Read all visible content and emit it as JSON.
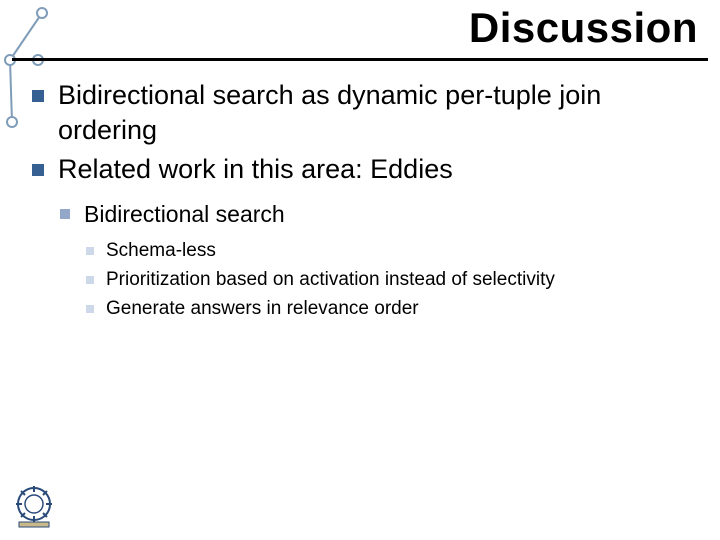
{
  "title": "Discussion",
  "bullets": {
    "b1": "Bidirectional search as dynamic per-tuple join ordering",
    "b2": "Related work in this area: Eddies",
    "b2_1": "Bidirectional search",
    "b2_1_a": "Schema-less",
    "b2_1_b": "Prioritization based on activation instead of selectivity",
    "b2_1_c": "Generate answers in relevance order"
  }
}
